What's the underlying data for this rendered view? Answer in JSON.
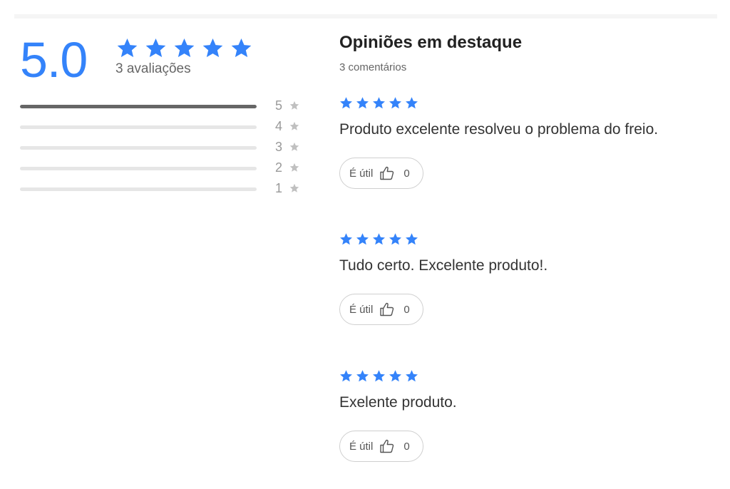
{
  "colors": {
    "accent": "#3483fa",
    "bar_fill": "#666666",
    "bar_track": "#e6e6e6",
    "muted_star": "#c0c0c0"
  },
  "summary": {
    "score": "5.0",
    "stars_filled": 5,
    "count_text": "3 avaliações",
    "distribution": [
      {
        "label": "5",
        "fraction": 1.0
      },
      {
        "label": "4",
        "fraction": 0.0
      },
      {
        "label": "3",
        "fraction": 0.0
      },
      {
        "label": "2",
        "fraction": 0.0
      },
      {
        "label": "1",
        "fraction": 0.0
      }
    ]
  },
  "reviews_section": {
    "title": "Opiniões em destaque",
    "subtitle": "3 comentários"
  },
  "reviews": [
    {
      "stars": 5,
      "text": "Produto excelente resolveu o problema do freio.",
      "useful_label": "É útil",
      "useful_count": "0",
      "icon": "thumbs-up-icon"
    },
    {
      "stars": 5,
      "text": "Tudo certo. Excelente produto!.",
      "useful_label": "É útil",
      "useful_count": "0",
      "icon": "thumbs-up-icon"
    },
    {
      "stars": 5,
      "text": "Exelente produto.",
      "useful_label": "É útil",
      "useful_count": "0",
      "icon": "thumbs-up-icon"
    }
  ]
}
